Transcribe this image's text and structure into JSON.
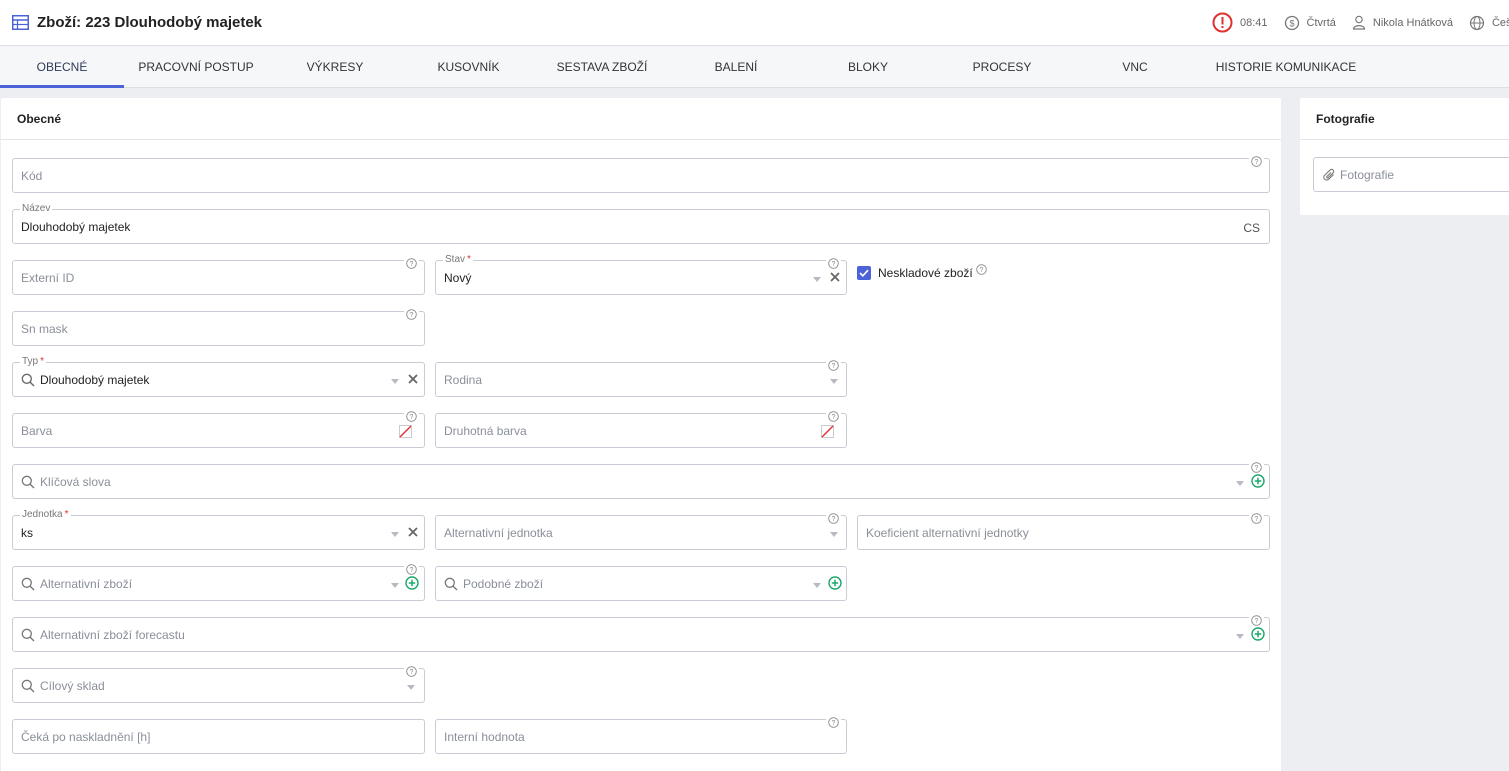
{
  "header": {
    "title": "Zboží: 223 Dlouhodobý majetek",
    "time": "08:41",
    "day": "Čtvrtá",
    "user": "Nikola Hnátková",
    "language": "Češ",
    "alert_color": "#e03131"
  },
  "tabs": [
    {
      "label": "OBECNÉ",
      "active": true
    },
    {
      "label": "PRACOVNÍ POSTUP"
    },
    {
      "label": "VÝKRESY"
    },
    {
      "label": "KUSOVNÍK"
    },
    {
      "label": "SESTAVA ZBOŽÍ"
    },
    {
      "label": "BALENÍ"
    },
    {
      "label": "BLOKY"
    },
    {
      "label": "PROCESY"
    },
    {
      "label": "VNC"
    },
    {
      "label": "HISTORIE KOMUNIKACE"
    }
  ],
  "general": {
    "heading": "Obecné",
    "kod": {
      "placeholder": "Kód"
    },
    "nazev": {
      "label": "Název",
      "value": "Dlouhodobý majetek",
      "lang": "CS"
    },
    "externi_id": {
      "placeholder": "Externí ID"
    },
    "stav": {
      "label": "Stav",
      "value": "Nový"
    },
    "neskladove": {
      "label": "Neskladové zboží",
      "checked": true
    },
    "sn_mask": {
      "placeholder": "Sn mask"
    },
    "typ": {
      "label": "Typ",
      "value": "Dlouhodobý majetek"
    },
    "rodina": {
      "placeholder": "Rodina"
    },
    "barva": {
      "placeholder": "Barva"
    },
    "druhotna_barva": {
      "placeholder": "Druhotná barva"
    },
    "klicova_slova": {
      "placeholder": "Klíčová slova"
    },
    "jednotka": {
      "label": "Jednotka",
      "value": "ks"
    },
    "alt_jednotka": {
      "placeholder": "Alternativní jednotka"
    },
    "koeficient": {
      "placeholder": "Koeficient alternativní jednotky"
    },
    "alt_zbozi": {
      "placeholder": "Alternativní zboží"
    },
    "podobne_zbozi": {
      "placeholder": "Podobné zboží"
    },
    "alt_zbozi_forecast": {
      "placeholder": "Alternativní zboží forecastu"
    },
    "cilovy_sklad": {
      "placeholder": "Cílový sklad"
    },
    "ceka": {
      "placeholder": "Čeká po naskladnění [h]"
    },
    "interni_hodnota": {
      "placeholder": "Interní hodnota"
    },
    "required_mark": "*"
  },
  "photo": {
    "heading": "Fotografie",
    "placeholder": "Fotografie"
  },
  "colors": {
    "accent": "#4b63d6",
    "add": "#1aa86b"
  }
}
